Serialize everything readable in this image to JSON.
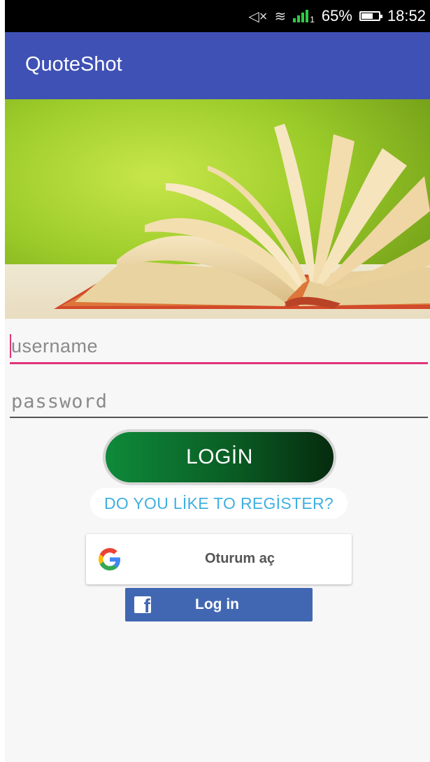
{
  "status_bar": {
    "mute_symbol": "◁×",
    "wifi_symbol": "≋",
    "sim_label": "1",
    "battery": "65%",
    "time": "18:52"
  },
  "app_bar": {
    "title": "QuoteShot"
  },
  "hero": {
    "subject": "open book on green background"
  },
  "form": {
    "username_placeholder": "username",
    "password_placeholder": "password",
    "login_label": "LOGİN",
    "register_label": "DO YOU LİKE TO REGİSTER?"
  },
  "social": {
    "google_label": "Oturum aç",
    "facebook_label": "Log in",
    "facebook_icon_letter": "f"
  },
  "colors": {
    "app_bar": "#3f51b5",
    "field_accent": "#e0357a",
    "login_button": "#0a5d24",
    "register_text": "#3fb0e0",
    "facebook_blue": "#4267b2"
  }
}
